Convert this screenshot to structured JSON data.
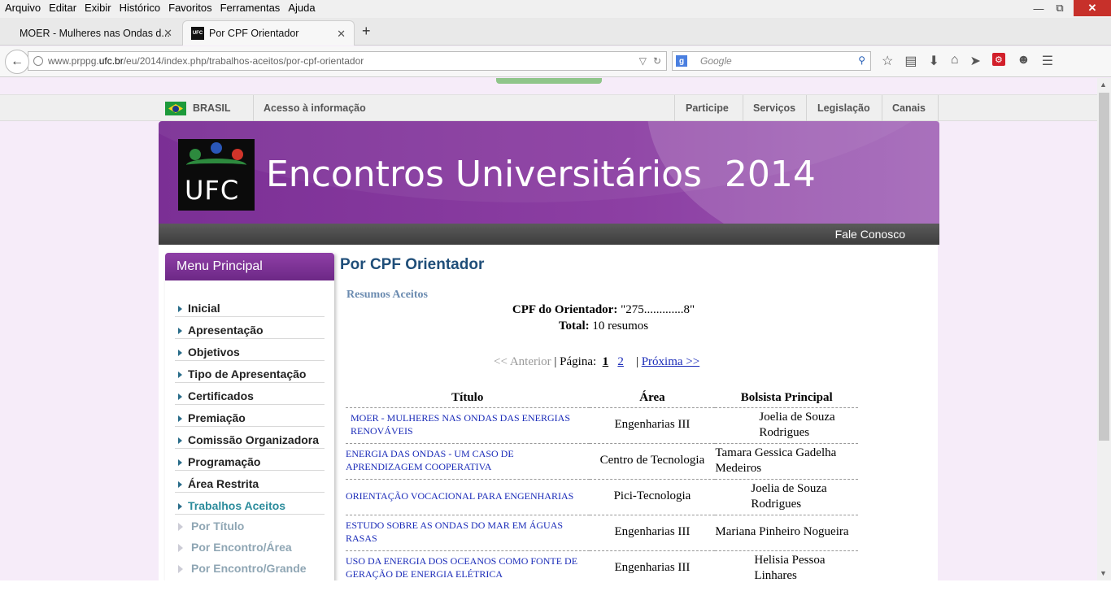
{
  "menubar": {
    "items": [
      "Arquivo",
      "Editar",
      "Exibir",
      "Histórico",
      "Favoritos",
      "Ferramentas",
      "Ajuda"
    ]
  },
  "tabs": [
    {
      "label": "MOER - Mulheres nas Ondas d..."
    },
    {
      "label": "Por CPF Orientador",
      "favicon": "UFC"
    }
  ],
  "address": {
    "url_prefix": "www.prppg.",
    "url_domain": "ufc.br",
    "url_suffix": "/eu/2014/index.php/trabalhos-aceitos/por-cpf-orientador"
  },
  "search": {
    "placeholder": "Google"
  },
  "govbar": {
    "brasil": "BRASIL",
    "acesso": "Acesso à informação",
    "links": [
      "Participe",
      "Serviços",
      "Legislação",
      "Canais"
    ]
  },
  "banner": {
    "logo_text": "UFC",
    "title": "Encontros Universitários  2014",
    "contact": "Fale Conosco"
  },
  "menu": {
    "header": "Menu Principal",
    "items": [
      "Inicial",
      "Apresentação",
      "Objetivos",
      "Tipo de Apresentação",
      "Certificados",
      "Premiação",
      "Comissão Organizadora",
      "Programação",
      "Área Restrita",
      "Trabalhos Aceitos"
    ],
    "subitems": [
      "Por Título",
      "Por Encontro/Área",
      "Por Encontro/Grande"
    ]
  },
  "main": {
    "title": "Por CPF Orientador",
    "section": "Resumos Aceitos",
    "cpf_label": "CPF do Orientador:",
    "cpf_value": "\"275.............8\"",
    "total_label": "Total:",
    "total_value": "10 resumos",
    "pager": {
      "prev": "<< Anterior",
      "page_label": "| Página:",
      "page1": "1",
      "page2": "2",
      "next": "Próxima >>"
    },
    "table": {
      "headers": [
        "Título",
        "Área",
        "Bolsista Principal"
      ],
      "rows": [
        {
          "titulo": "MOER - MULHERES NAS ONDAS DAS ENERGIAS RENOVÁVEIS",
          "area": "Engenharias III",
          "bolsista": "Joelia de Souza Rodrigues"
        },
        {
          "titulo": "ENERGIA DAS ONDAS - UM CASO DE APRENDIZAGEM COOPERATIVA",
          "area": "Centro de Tecnologia",
          "bolsista": "Tamara Gessica Gadelha Medeiros"
        },
        {
          "titulo": "ORIENTAÇÃO VOCACIONAL PARA ENGENHARIAS",
          "area": "Pici-Tecnologia",
          "bolsista": "Joelia de Souza Rodrigues"
        },
        {
          "titulo": "ESTUDO SOBRE AS ONDAS DO MAR EM ÁGUAS RASAS",
          "area": "Engenharias III",
          "bolsista": "Mariana Pinheiro Nogueira"
        },
        {
          "titulo": "USO DA ENERGIA DOS OCEANOS COMO FONTE DE GERAÇÃO DE ENERGIA ELÉTRICA",
          "area": "Engenharias III",
          "bolsista": "Helisia Pessoa Linhares"
        }
      ]
    }
  }
}
